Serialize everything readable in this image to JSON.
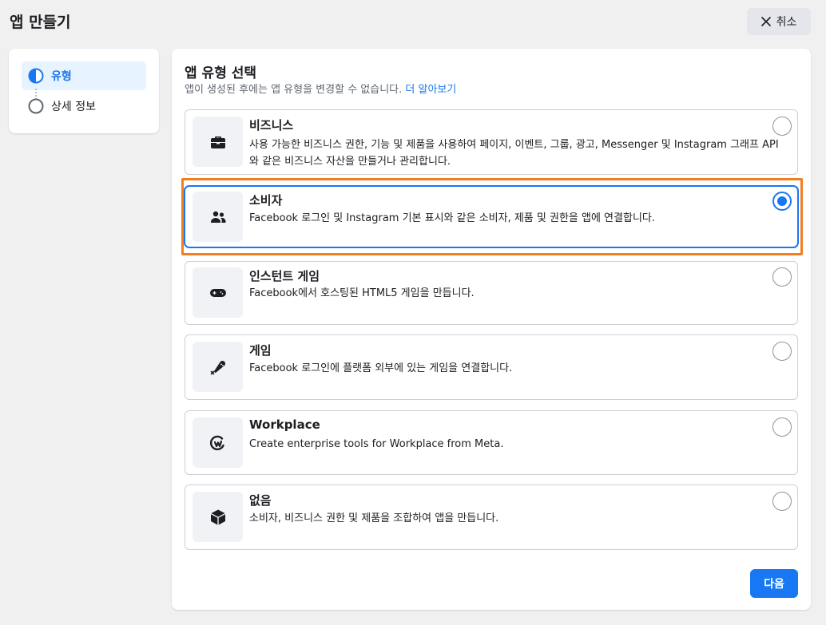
{
  "header": {
    "title": "앱 만들기",
    "cancel_label": "취소"
  },
  "stepper": {
    "steps": [
      {
        "label": "유형",
        "state": "active"
      },
      {
        "label": "상세 정보",
        "state": "pending"
      }
    ]
  },
  "main": {
    "title": "앱 유형 선택",
    "subtitle": "앱이 생성된 후에는 앱 유형을 변경할 수 없습니다.",
    "learn_more": "더 알아보기",
    "options": [
      {
        "title": "비즈니스",
        "description": "사용 가능한 비즈니스 권한, 기능 및 제품을 사용하여 페이지, 이벤트, 그룹, 광고, Messenger 및 Instagram 그래프 API와 같은 비즈니스 자산을 만들거나 관리합니다.",
        "icon": "briefcase-icon",
        "selected": false
      },
      {
        "title": "소비자",
        "description": "Facebook 로그인 및 Instagram 기본 표시와 같은 소비자, 제품 및 권한을 앱에 연결합니다.",
        "icon": "people-icon",
        "selected": true
      },
      {
        "title": "인스턴트 게임",
        "description": "Facebook에서 호스팅된 HTML5 게임을 만듭니다.",
        "icon": "gamepad-icon",
        "selected": false
      },
      {
        "title": "게임",
        "description": "Facebook 로그인에 플랫폼 외부에 있는 게임을 연결합니다.",
        "icon": "game-controller-icon",
        "selected": false
      },
      {
        "title": "Workplace",
        "description": "Create enterprise tools for Workplace from Meta.",
        "icon": "workplace-icon",
        "selected": false
      },
      {
        "title": "없음",
        "description": "소비자, 비즈니스 권한 및 제품을 조합하여 앱을 만듭니다.",
        "icon": "cube-icon",
        "selected": false
      }
    ],
    "next_label": "다음"
  },
  "colors": {
    "accent": "#1877f2",
    "highlight": "#f27e20",
    "background": "#f0f0f0"
  }
}
